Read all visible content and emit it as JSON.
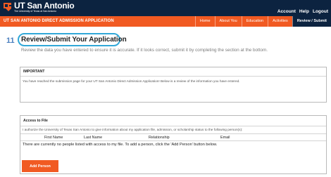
{
  "brand": {
    "title": "UT San Antonio",
    "subtitle": "The University of Texas at San Antonio",
    "logo_icon": "roadrunner-logo-icon"
  },
  "top_links": [
    "Account",
    "Help",
    "Logout"
  ],
  "navbar": {
    "app_title": "UT SAN ANTONIO DIRECT ADMISSION APPLICATION",
    "items": [
      "Home",
      "About You",
      "Education",
      "Activities",
      "Review / Submit"
    ],
    "active_index": 4
  },
  "section": {
    "number": "11",
    "heading": "Review/Submit Your Application",
    "intro": "Review the data you have entered to ensure it is accurate. If it looks correct, submit it by completing the section at the bottom."
  },
  "important_panel": {
    "header": "IMPORTANT",
    "body": "You have reached the submission page for your UT San Antonio Direct Admission Application! Below is a review of the information you have entered."
  },
  "access_panel": {
    "header": "Access to File",
    "authorization_text": "I authorize the University of Texas San Antonio to give information about my application file, admission, or scholarship status to the following person(s):",
    "columns": [
      "First Name",
      "Last Name",
      "Relationship",
      "Email"
    ],
    "empty_message": "There are currently no people listed with access to my file. To add a person, click the 'Add Person' button below.",
    "add_button": "Add Person"
  },
  "colors": {
    "navy": "#0c2340",
    "orange": "#f15a22",
    "highlight": "#31a8d8",
    "step_number": "#4a7fbf"
  }
}
